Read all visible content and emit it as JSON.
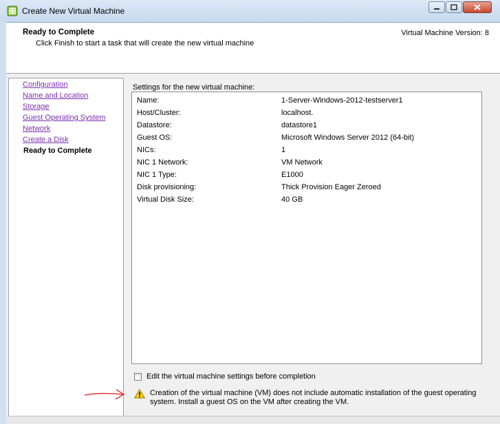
{
  "window": {
    "title": "Create New Virtual Machine"
  },
  "header": {
    "title": "Ready to Complete",
    "subtitle": "Click Finish to start a task that will create the new virtual machine",
    "version": "Virtual Machine Version: 8"
  },
  "nav": {
    "items": [
      {
        "label": "Configuration"
      },
      {
        "label": "Name and Location"
      },
      {
        "label": "Storage"
      },
      {
        "label": "Guest Operating System"
      },
      {
        "label": "Network"
      },
      {
        "label": "Create a Disk"
      },
      {
        "label": "Ready to Complete"
      }
    ]
  },
  "settings": {
    "heading": "Settings for the new virtual machine:",
    "rows": [
      {
        "key": "Name:",
        "value": "1-Server-Windows-2012-testserver1"
      },
      {
        "key": "Host/Cluster:",
        "value": "localhost."
      },
      {
        "key": "Datastore:",
        "value": "datastore1"
      },
      {
        "key": "Guest OS:",
        "value": "Microsoft Windows Server 2012 (64-bit)"
      },
      {
        "key": "NICs:",
        "value": "1"
      },
      {
        "key": "NIC 1 Network:",
        "value": "VM Network"
      },
      {
        "key": "NIC 1 Type:",
        "value": "E1000"
      },
      {
        "key": "Disk provisioning:",
        "value": "Thick Provision Eager Zeroed"
      },
      {
        "key": "Virtual Disk Size:",
        "value": "40 GB"
      }
    ]
  },
  "edit_checkbox": {
    "label": "Edit the virtual machine settings before completion",
    "checked": false
  },
  "warning": {
    "text": "Creation of the virtual machine (VM) does not include automatic installation of the guest operating system. Install a guest OS on the VM after creating the VM."
  },
  "colors": {
    "link": "#7c2fb0",
    "annotation_arrow": "#e03030",
    "warning_yellow": "#f5d000"
  }
}
